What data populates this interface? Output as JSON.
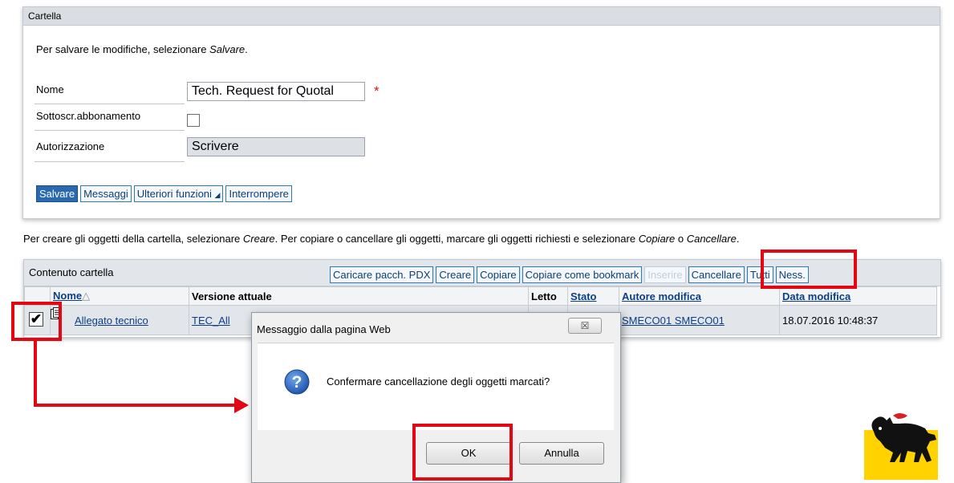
{
  "cartella": {
    "title": "Cartella",
    "hint_prefix": "Per salvare le modifiche, selezionare ",
    "hint_em": "Salvare",
    "hint_suffix": ".",
    "nome_label": "Nome",
    "nome_value": "Tech. Request for Quotal",
    "required_mark": "*",
    "sottoscr_label": "Sottoscr.abbonamento",
    "sottoscr_checked": false,
    "autorizzazione_label": "Autorizzazione",
    "autorizzazione_value": "Scrivere",
    "buttons": {
      "salvare": "Salvare",
      "messaggi": "Messaggi",
      "ulteriori": "Ulteriori funzioni",
      "ulteriori_arrow": "◢",
      "interrompere": "Interrompere"
    }
  },
  "instruction": {
    "p1": "Per creare gli oggetti della cartella, selezionare ",
    "em1": "Creare",
    "p2": ". Per copiare o cancellare gli oggetti, marcare gli oggetti richiesti e selezionare ",
    "em2": "Copiare",
    "p3": " o ",
    "em3": "Cancellare",
    "p4": "."
  },
  "contenuto": {
    "title": "Contenuto cartella",
    "buttons": {
      "caricare": "Caricare pacch. PDX",
      "creare": "Creare",
      "copiare": "Copiare",
      "copiare_bookmark": "Copiare come bookmark",
      "inserire": "Inserire",
      "cancellare": "Cancellare",
      "tutti": "Tutti",
      "ness": "Ness."
    },
    "columns": {
      "nome": "Nome",
      "sort_icon": "△",
      "versione": "Versione attuale",
      "letto": "Letto",
      "stato": "Stato",
      "autore": "Autore modifica",
      "data": "Data modifica"
    },
    "rows": [
      {
        "checked": true,
        "check_glyph": "✔",
        "nome": "Allegato tecnico",
        "versione": "TEC_All",
        "letto": "",
        "stato": "",
        "autore": "SMECO01 SMECO01",
        "data": "18.07.2016 10:48:37"
      }
    ]
  },
  "dialog": {
    "title": "Messaggio dalla pagina Web",
    "close_glyph": "☒",
    "message": "Confermare cancellazione degli oggetti marcati?",
    "question_glyph": "?",
    "ok_label": "OK",
    "cancel_label": "Annulla"
  },
  "colors": {
    "highlight": "#e30613",
    "primary_button": "#2a69b0",
    "link": "#0b3e86",
    "logo_yellow": "#ffd200"
  },
  "icons": [
    "document-icon",
    "question-icon",
    "close-icon",
    "sort-ascending-icon",
    "six-legged-dog-logo"
  ]
}
